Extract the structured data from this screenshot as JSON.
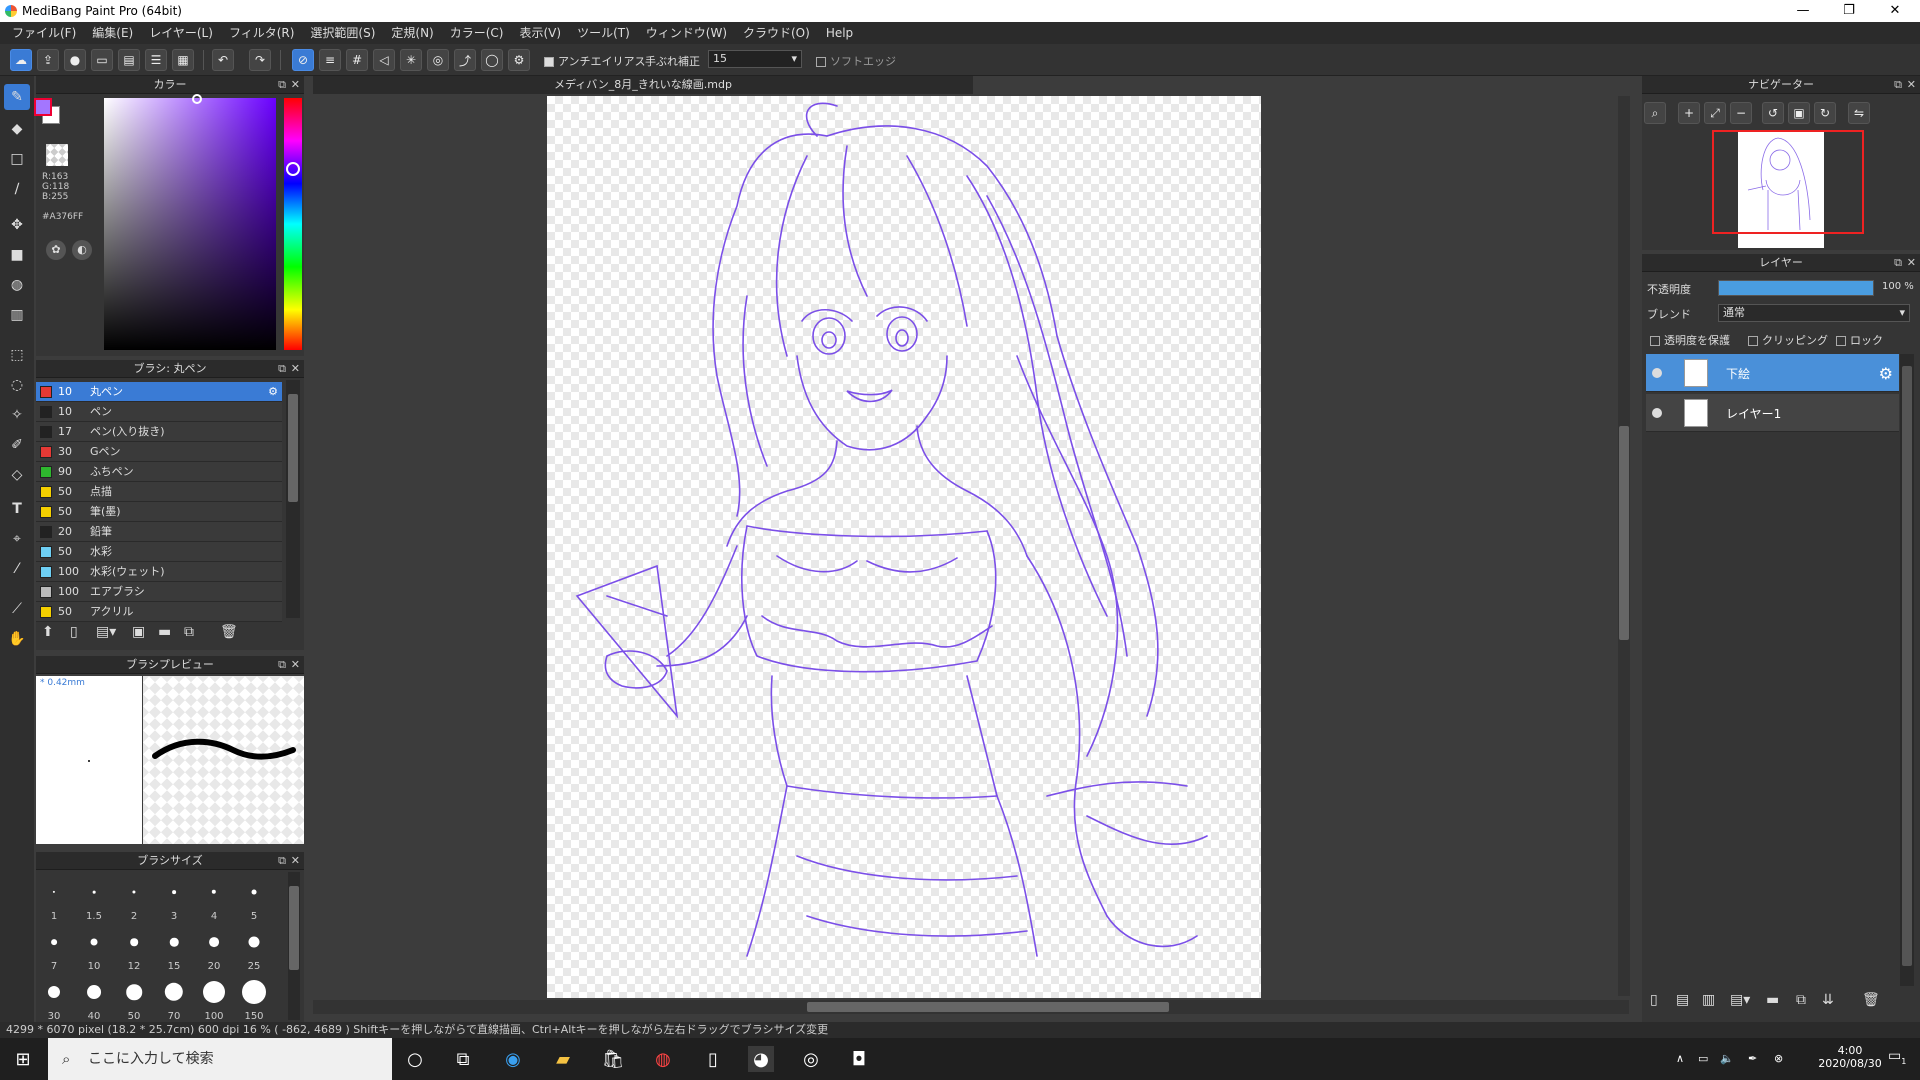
{
  "window": {
    "title": "MediBang Paint Pro (64bit)",
    "minimize": "—",
    "maximize": "❐",
    "close": "✕"
  },
  "menu": [
    "ファイル(F)",
    "編集(E)",
    "レイヤー(L)",
    "フィルタ(R)",
    "選択範囲(S)",
    "定規(N)",
    "カラー(C)",
    "表示(V)",
    "ツール(T)",
    "ウィンドウ(W)",
    "クラウド(O)",
    "Help"
  ],
  "toolbar": {
    "antialias_label": "アンチエイリアス",
    "stabilizer_label": "手ぶれ補正",
    "stabilizer_value": "15",
    "softedge_label": "ソフトエッジ"
  },
  "color_panel": {
    "title": "カラー",
    "r": "R:163",
    "g": "G:118",
    "b": "B:255",
    "hex": "#A376FF",
    "foreground": "#A376FF"
  },
  "brush_panel": {
    "title": "ブラシ: 丸ペン",
    "items": [
      {
        "size": "10",
        "name": "丸ペン",
        "color": "#e53935"
      },
      {
        "size": "10",
        "name": "ペン",
        "color": "#222222"
      },
      {
        "size": "17",
        "name": "ペン(入り抜き)",
        "color": "#222222"
      },
      {
        "size": "30",
        "name": "Gペン",
        "color": "#e53935"
      },
      {
        "size": "90",
        "name": "ふちペン",
        "color": "#2eb82e"
      },
      {
        "size": "50",
        "name": "点描",
        "color": "#f5d000"
      },
      {
        "size": "50",
        "name": "筆(墨)",
        "color": "#f5d000"
      },
      {
        "size": "20",
        "name": "鉛筆",
        "color": "#222222"
      },
      {
        "size": "50",
        "name": "水彩",
        "color": "#6fd0f5"
      },
      {
        "size": "100",
        "name": "水彩(ウェット)",
        "color": "#6fd0f5"
      },
      {
        "size": "100",
        "name": "エアブラシ",
        "color": "#bbbbbb"
      },
      {
        "size": "50",
        "name": "アクリル",
        "color": "#f5d000"
      }
    ]
  },
  "brush_preview": {
    "title": "ブラシプレビュー",
    "size_text": "* 0.42mm"
  },
  "brush_size": {
    "title": "ブラシサイズ",
    "sizes": [
      "1",
      "1.5",
      "2",
      "3",
      "4",
      "5",
      "7",
      "10",
      "12",
      "15",
      "20",
      "25",
      "30",
      "40",
      "50",
      "70",
      "100",
      "150"
    ]
  },
  "document": {
    "tab": "メディバン_8月_きれいな線画.mdp"
  },
  "navigator": {
    "title": "ナビゲーター"
  },
  "layers": {
    "title": "レイヤー",
    "opacity_label": "不透明度",
    "opacity_value": "100 %",
    "opacity": 1.0,
    "blend_label": "ブレンド",
    "blend_value": "通常",
    "protect_alpha": "透明度を保護",
    "clipping": "クリッピング",
    "lock": "ロック",
    "items": [
      {
        "name": "下絵",
        "selected": true
      },
      {
        "name": "レイヤー1",
        "selected": false
      }
    ]
  },
  "status": {
    "text": "4299 * 6070 pixel  (18.2 * 25.7cm)  600 dpi  16 %  ( -862, 4689 )  Shiftキーを押しながらで直線描画、Ctrl+Altキーを押しながら左右ドラッグでブラシサイズ変更"
  },
  "taskbar": {
    "search_placeholder": "ここに入力して検索",
    "time": "4:00",
    "date": "2020/08/30",
    "notification_count": "1"
  }
}
